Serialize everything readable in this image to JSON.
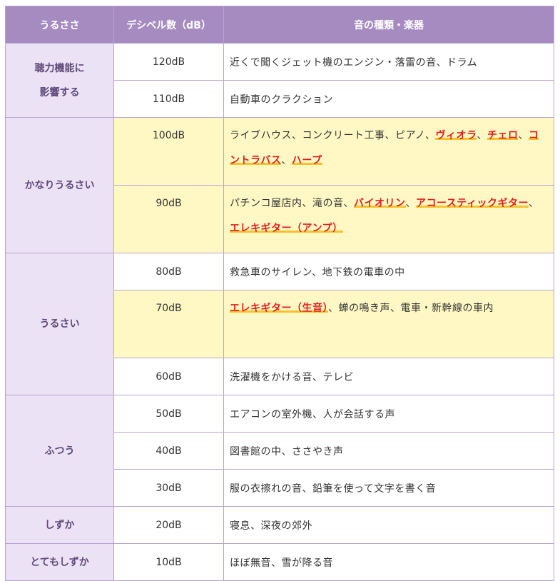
{
  "headers": [
    "うるささ",
    "デシベル数（dB）",
    "音の種類・楽器"
  ],
  "groups": [
    {
      "label_lines": [
        "聴力機能に",
        "影響する"
      ],
      "rows": [
        {
          "db": "120dB",
          "desc": [
            {
              "t": "近くで聞くジェット機のエンジン・落雷の音、ドラム"
            }
          ]
        },
        {
          "db": "110dB",
          "desc": [
            {
              "t": "自動車のクラクション"
            }
          ]
        }
      ]
    },
    {
      "label_lines": [
        "かなりうるさい"
      ],
      "rows": [
        {
          "db": "100dB",
          "highlight": true,
          "desc": [
            {
              "t": "ライブハウス、コンクリート工事、ピアノ、"
            },
            {
              "t": "ヴィオラ",
              "inst": true
            },
            {
              "t": "、"
            },
            {
              "t": "チェロ",
              "inst": true
            },
            {
              "t": "、"
            },
            {
              "t": "コントラバス",
              "inst": true
            },
            {
              "t": "、"
            },
            {
              "t": "ハープ",
              "inst": true
            }
          ]
        },
        {
          "db": "90dB",
          "highlight": true,
          "desc": [
            {
              "t": "パチンコ屋店内、滝の音、"
            },
            {
              "t": "バイオリン",
              "inst": true
            },
            {
              "t": "、"
            },
            {
              "t": "アコースティックギター",
              "inst": true
            },
            {
              "t": "、"
            },
            {
              "t": "エレキギター（アンプ）",
              "inst": true
            }
          ]
        }
      ]
    },
    {
      "label_lines": [
        "うるさい"
      ],
      "rows": [
        {
          "db": "80dB",
          "desc": [
            {
              "t": "救急車のサイレン、地下鉄の電車の中"
            }
          ]
        },
        {
          "db": "70dB",
          "highlight": true,
          "desc": [
            {
              "t": "エレキギター（生音）",
              "inst": true
            },
            {
              "t": "、蝉の鳴き声、電車・新幹線の車内"
            }
          ]
        },
        {
          "db": "60dB",
          "desc": [
            {
              "t": "洗濯機をかける音、テレビ"
            }
          ]
        }
      ]
    },
    {
      "label_lines": [
        "ふつう"
      ],
      "rows": [
        {
          "db": "50dB",
          "desc": [
            {
              "t": "エアコンの室外機、人が会話する声"
            }
          ]
        },
        {
          "db": "40dB",
          "desc": [
            {
              "t": "図書館の中、ささやき声"
            }
          ]
        },
        {
          "db": "30dB",
          "desc": [
            {
              "t": "服の衣擦れの音、鉛筆を使って文字を書く音"
            }
          ]
        }
      ]
    },
    {
      "label_lines": [
        "しずか"
      ],
      "rows": [
        {
          "db": "20dB",
          "desc": [
            {
              "t": "寝息、深夜の郊外"
            }
          ]
        }
      ]
    },
    {
      "label_lines": [
        "とてもしずか"
      ],
      "rows": [
        {
          "db": "10dB",
          "desc": [
            {
              "t": "ほぼ無音、雪が降る音"
            }
          ]
        }
      ]
    }
  ]
}
